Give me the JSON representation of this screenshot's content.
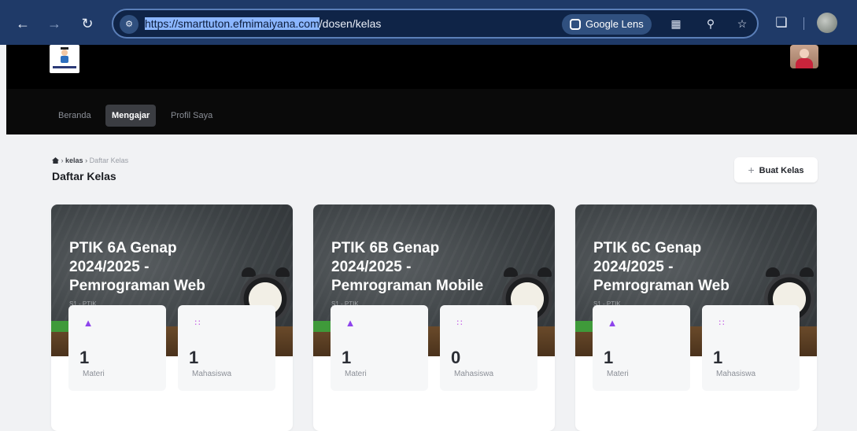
{
  "browser": {
    "url_selected": "https://smarttuton.efmimaiyana.com",
    "url_rest": "/dosen/kelas",
    "lens_label": "Google Lens"
  },
  "nav": {
    "items": [
      {
        "label": "Beranda"
      },
      {
        "label": "Mengajar"
      },
      {
        "label": "Profil Saya"
      }
    ]
  },
  "breadcrumb": {
    "home_icon": "home-icon",
    "sep": "›",
    "kelas": "kelas",
    "current": "Daftar Kelas"
  },
  "page": {
    "title": "Daftar Kelas",
    "add_button": "Buat Kelas"
  },
  "cards": [
    {
      "title": "PTIK 6A Genap 2024/2025 - Pemrograman Web",
      "subtitle": "S1 - PTIK",
      "materi_count": "1",
      "materi_label": "Materi",
      "mahasiswa_count": "1",
      "mahasiswa_label": "Mahasiswa"
    },
    {
      "title": "PTIK 6B Genap 2024/2025 - Pemrograman Mobile",
      "subtitle": "S1 - PTIK",
      "materi_count": "1",
      "materi_label": "Materi",
      "mahasiswa_count": "0",
      "mahasiswa_label": "Mahasiswa"
    },
    {
      "title": "PTIK 6C Genap 2024/2025 - Pemrograman Web",
      "subtitle": "S1 - PTIK",
      "materi_count": "1",
      "materi_label": "Materi",
      "mahasiswa_count": "1",
      "mahasiswa_label": "Mahasiswa"
    }
  ]
}
